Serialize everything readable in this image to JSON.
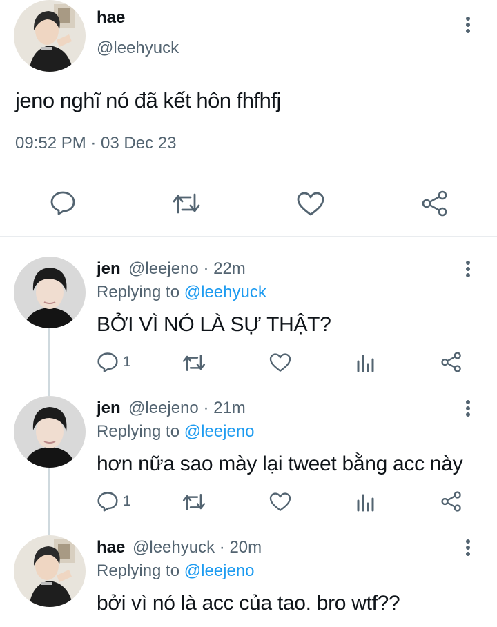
{
  "main_tweet": {
    "author_name": "hae",
    "author_handle": "@leehyuck",
    "text": "jeno nghĩ nó đã kết hôn fhfhfj",
    "timestamp": "09:52 PM · 03 Dec 23",
    "actions": [
      "reply",
      "retweet",
      "like",
      "share"
    ]
  },
  "replies": [
    {
      "author_name": "jen",
      "author_handle": "@leejeno",
      "age": "22m",
      "replying_prefix": "Replying to",
      "replying_to": "@leehyuck",
      "text": "BỞI VÌ NÓ LÀ SỰ THẬT?",
      "reply_count": "1"
    },
    {
      "author_name": "jen",
      "author_handle": "@leejeno",
      "age": "21m",
      "replying_prefix": "Replying to",
      "replying_to": "@leejeno",
      "text": "hơn nữa sao mày lại tweet bằng acc này",
      "reply_count": "1"
    },
    {
      "author_name": "hae",
      "author_handle": "@leehyuck",
      "age": "20m",
      "replying_prefix": "Replying to",
      "replying_to": "@leejeno",
      "text": "bởi vì nó là acc của tao. bro wtf??"
    }
  ],
  "separator": "·",
  "colors": {
    "text": "#0f1419",
    "muted": "#536471",
    "mention": "#1d9bf0",
    "divider": "#e6e9ec"
  },
  "icons": [
    "more-vertical-icon",
    "reply-icon",
    "retweet-icon",
    "like-icon",
    "share-icon",
    "analytics-icon"
  ]
}
